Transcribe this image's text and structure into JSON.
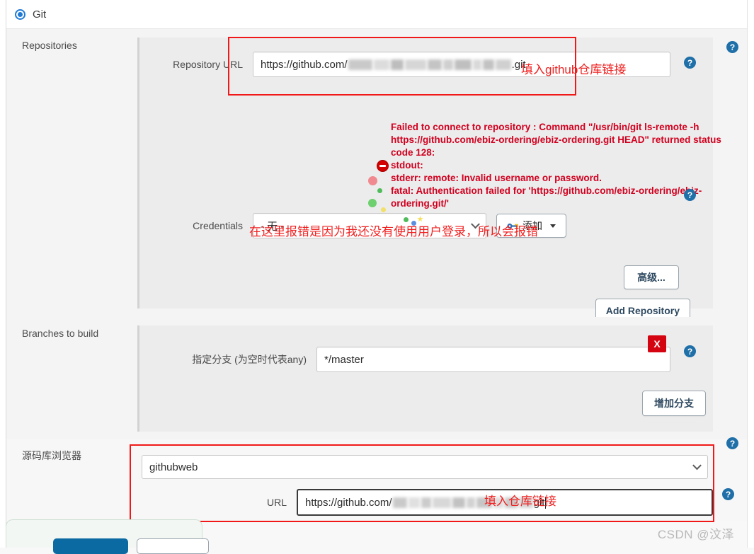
{
  "scm": {
    "selected_label": "Git",
    "radio_name": "scm-git-radio"
  },
  "repositories": {
    "section_label": "Repositories",
    "url_label": "Repository URL",
    "url_prefix": "https://github.com/",
    "url_suffix": ".git",
    "url_redacted": true,
    "url_annotation": "填入github仓库链接",
    "error": {
      "line1": "Failed to connect to repository : Command \"/usr/bin/git ls-remote -h",
      "line2": "https://github.com/ebiz-ordering/ebiz-ordering.git HEAD\" returned status",
      "line3": "code 128:",
      "line4": "stdout:",
      "line5": "stderr: remote: Invalid username or password.",
      "line6": "fatal: Authentication failed for 'https://github.com/ebiz-ordering/ebiz-",
      "line7": "ordering.git/'"
    },
    "credentials_label": "Credentials",
    "credentials_value": "- 无 -",
    "add_credentials_label": "添加",
    "credentials_annotation": "在这里报错是因为我还没有使用用户登录，所以会报错",
    "advanced_label": "高级...",
    "add_repository_label": "Add Repository"
  },
  "branches": {
    "section_label": "Branches to build",
    "branch_label": "指定分支 (为空时代表any)",
    "branch_value": "*/master",
    "delete_label": "X",
    "add_branch_label": "增加分支"
  },
  "browser": {
    "section_label": "源码库浏览器",
    "selected_browser": "githubweb",
    "url_label": "URL",
    "url_prefix": "https://github.com/",
    "url_suffix": "git",
    "url_redacted": true,
    "url_annotation": "填入仓库链接"
  },
  "help_icon_glyph": "?",
  "watermark": "CSDN @汶泽",
  "colors": {
    "accent_blue": "#1f7bd6",
    "help_blue": "#1f6fa8",
    "error_red": "#d2001f",
    "annotation_red": "#f02020",
    "delete_red": "#d40511",
    "panel_bg": "#ececec"
  }
}
